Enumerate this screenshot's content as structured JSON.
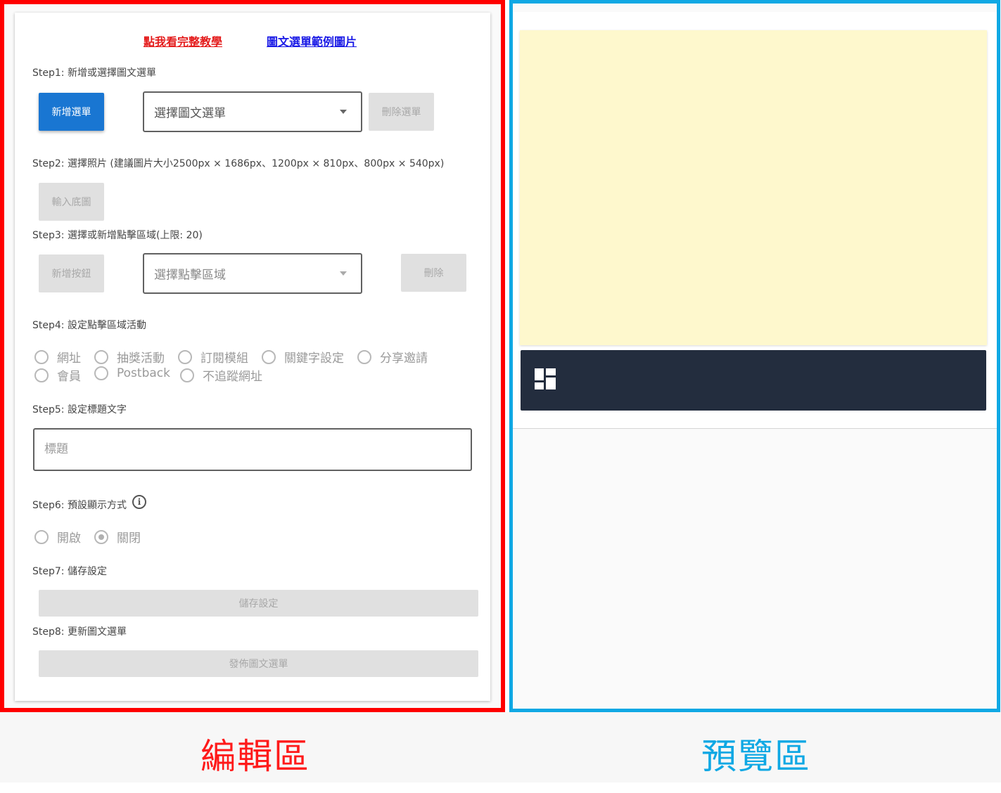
{
  "editor": {
    "links": {
      "tutorial": "點我看完整教學",
      "example": "圖文選單範例圖片"
    },
    "step1": {
      "label": "Step1: 新增或選擇圖文選單",
      "add_button": "新增選單",
      "select_value": "選擇圖文選單",
      "delete_button": "刪除選單"
    },
    "step2": {
      "label": "Step2: 選擇照片 (建議圖片大小2500px × 1686px、1200px × 810px、800px × 540px)",
      "upload_button": "輸入底圖"
    },
    "step3": {
      "label": "Step3: 選擇或新增點擊區域(上限: 20)",
      "add_button": "新增按鈕",
      "select_value": "選擇點擊區域",
      "delete_button": "刪除"
    },
    "step4": {
      "label": "Step4: 設定點擊區域活動",
      "options": [
        "網址",
        "抽獎活動",
        "訂閱模組",
        "關鍵字設定",
        "分享邀請",
        "會員",
        "Postback",
        "不追蹤網址"
      ]
    },
    "step5": {
      "label": "Step5: 設定標題文字",
      "title_placeholder": "標題"
    },
    "step6": {
      "label": "Step6: 預設顯示方式",
      "info_glyph": "i",
      "options": [
        "開啟",
        "關閉"
      ],
      "selected": "關閉"
    },
    "step7": {
      "label": "Step7: 儲存設定",
      "save_button": "儲存設定"
    },
    "step8": {
      "label": "Step8: 更新圖文選單",
      "publish_button": "發佈圖文選單"
    }
  },
  "captions": {
    "editor": "編輯區",
    "preview": "預覽區"
  },
  "colors": {
    "editor_frame": "#ff0000",
    "preview_frame": "#0fa8e4",
    "primary_button": "#1976d2",
    "preview_image": "#fef8cd",
    "preview_bar": "#232d3e",
    "tutorial_link": "#e41c1c",
    "example_link": "#1a1ae6"
  },
  "icons": {
    "info": "info-icon",
    "rich_menu": "dashboard-icon"
  }
}
